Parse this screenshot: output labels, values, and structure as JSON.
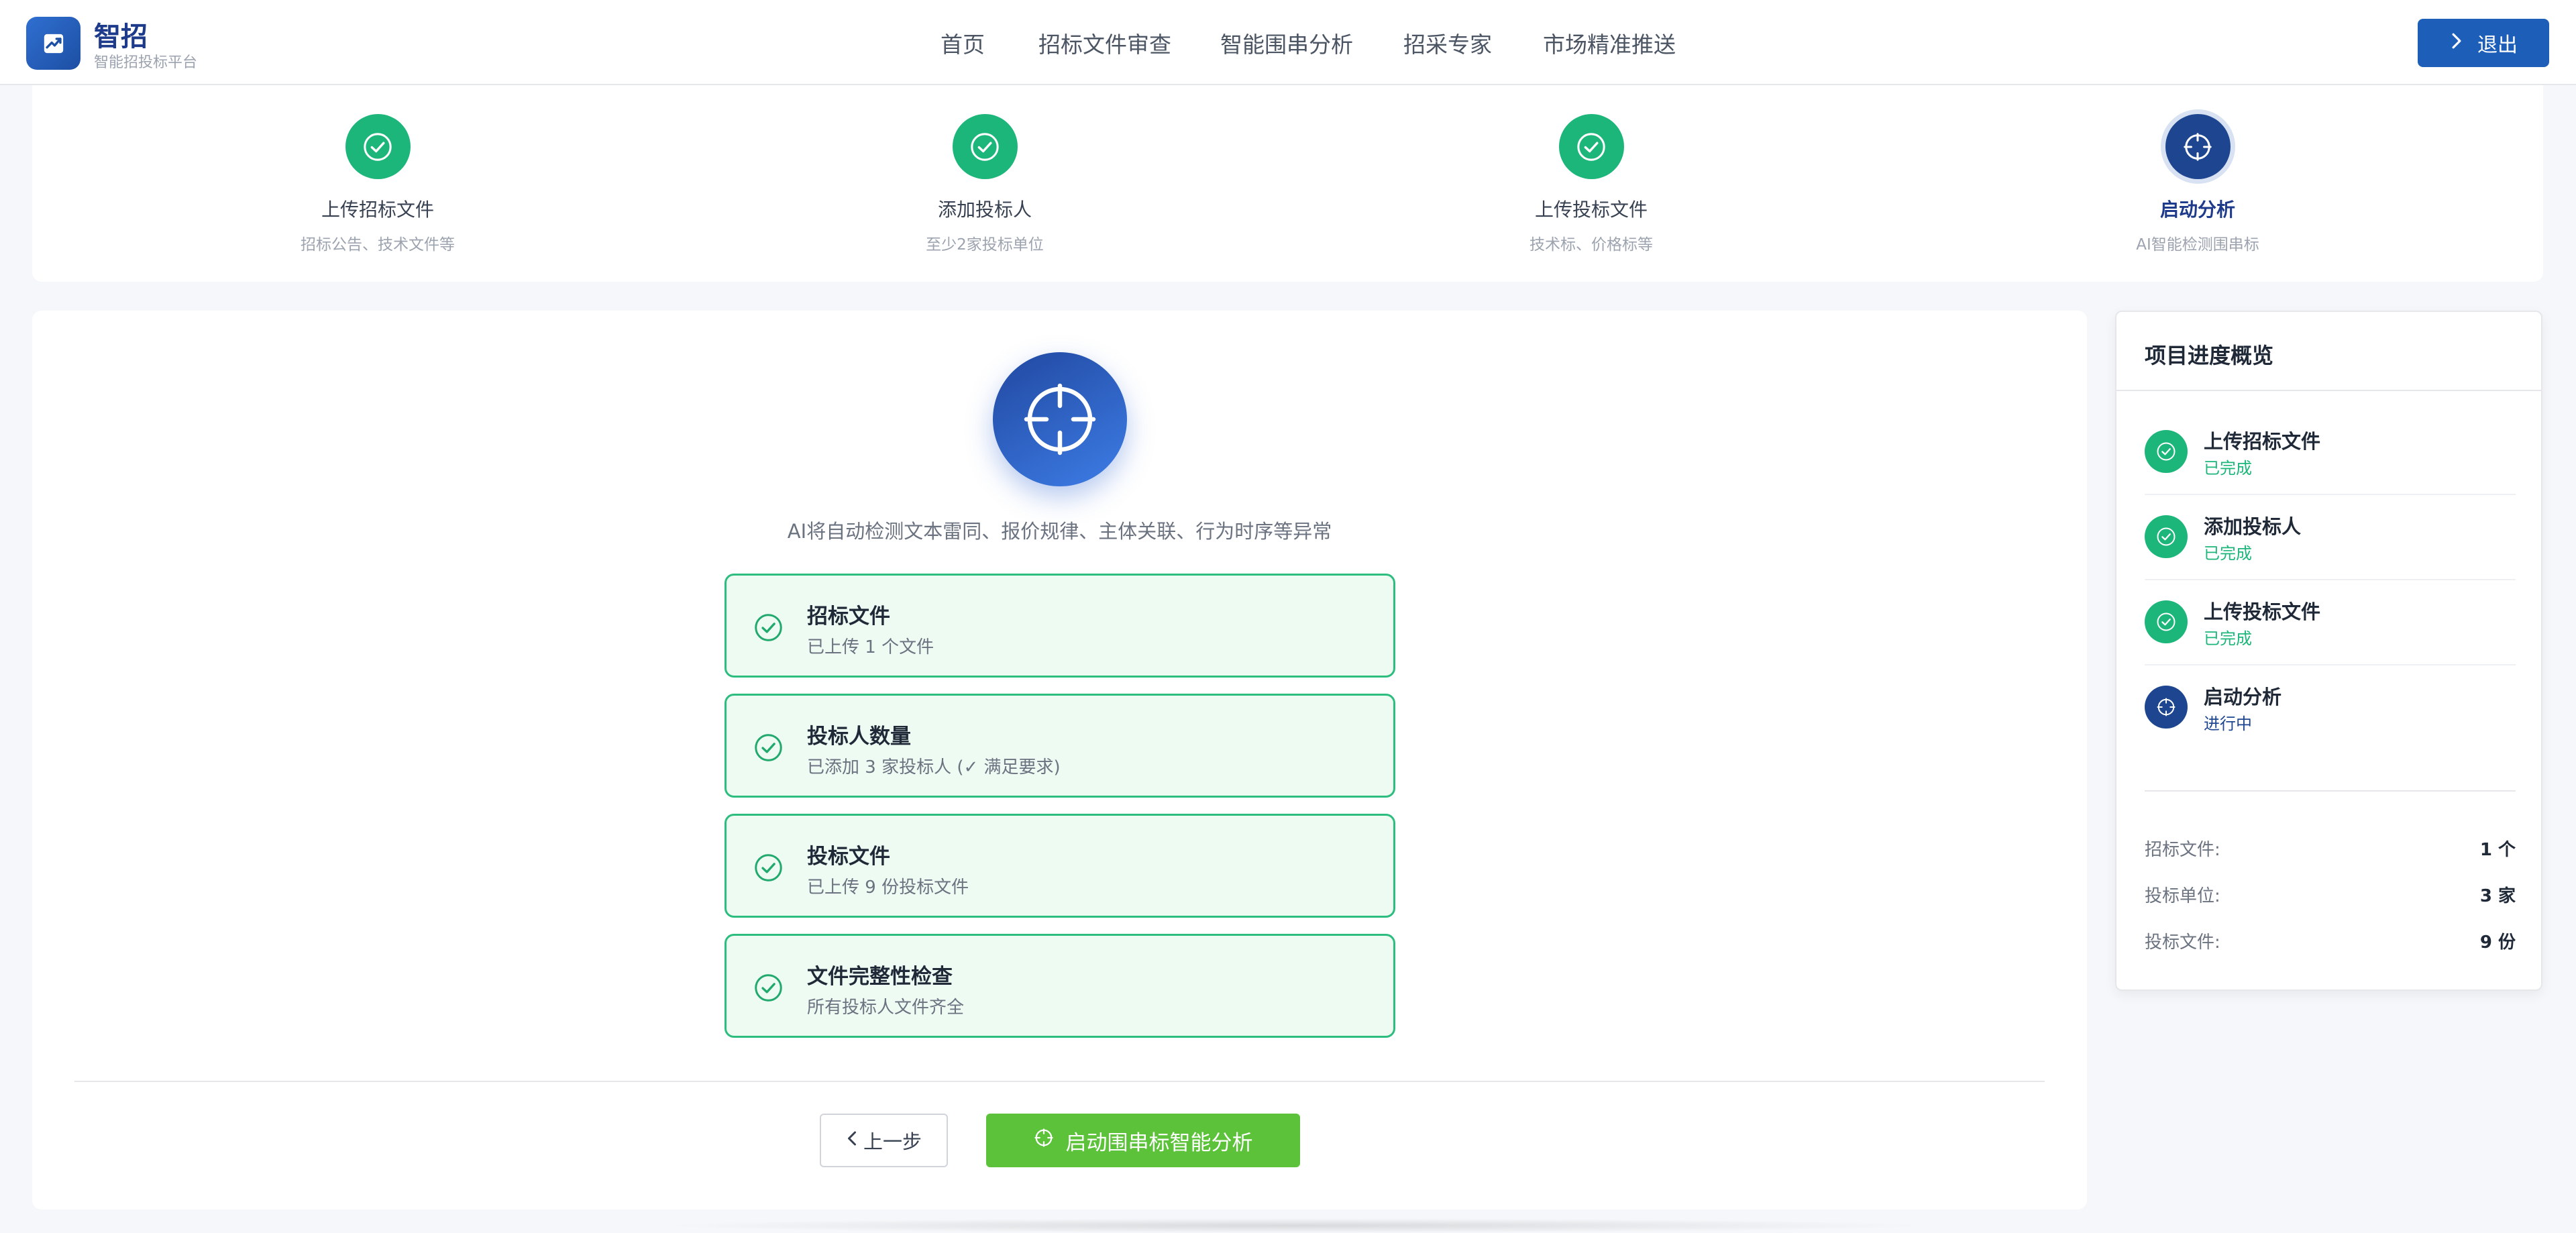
{
  "header": {
    "logo_title": "智招",
    "logo_subtitle": "智能招投标平台",
    "nav": [
      "首页",
      "招标文件审查",
      "智能围串分析",
      "招采专家",
      "市场精准推送"
    ],
    "logout_label": "退出"
  },
  "stepper": {
    "steps": [
      {
        "title": "上传招标文件",
        "desc": "招标公告、技术文件等",
        "state": "done"
      },
      {
        "title": "添加投标人",
        "desc": "至少2家投标单位",
        "state": "done"
      },
      {
        "title": "上传投标文件",
        "desc": "技术标、价格标等",
        "state": "done"
      },
      {
        "title": "启动分析",
        "desc": "AI智能检测围串标",
        "state": "active"
      }
    ]
  },
  "main": {
    "hero_text": "AI将自动检测文本雷同、报价规律、主体关联、行为时序等异常",
    "checks": [
      {
        "title": "招标文件",
        "desc": "已上传 1 个文件"
      },
      {
        "title": "投标人数量",
        "desc": "已添加 3 家投标人 (✓ 满足要求)"
      },
      {
        "title": "投标文件",
        "desc": "已上传 9 份投标文件"
      },
      {
        "title": "文件完整性检查",
        "desc": "所有投标人文件齐全"
      }
    ],
    "prev_label": "上一步",
    "start_label": "启动围串标智能分析"
  },
  "side": {
    "title": "项目进度概览",
    "steps": [
      {
        "title": "上传招标文件",
        "status": "已完成",
        "state": "done"
      },
      {
        "title": "添加投标人",
        "status": "已完成",
        "state": "done"
      },
      {
        "title": "上传投标文件",
        "status": "已完成",
        "state": "done"
      },
      {
        "title": "启动分析",
        "status": "进行中",
        "state": "active"
      }
    ],
    "stats": [
      {
        "label": "招标文件:",
        "value": "1 个"
      },
      {
        "label": "投标单位:",
        "value": "3 家"
      },
      {
        "label": "投标文件:",
        "value": "9 份"
      }
    ]
  },
  "colors": {
    "brand": "#1d5fb8",
    "done": "#1db67a",
    "active": "#1e4690",
    "start_button": "#5cc23a"
  },
  "icons": {
    "logo": "trend-chart-icon",
    "done": "check-circle-icon",
    "active": "crosshair-icon",
    "logout": "chevron-right-icon",
    "prev": "chevron-left-icon"
  }
}
